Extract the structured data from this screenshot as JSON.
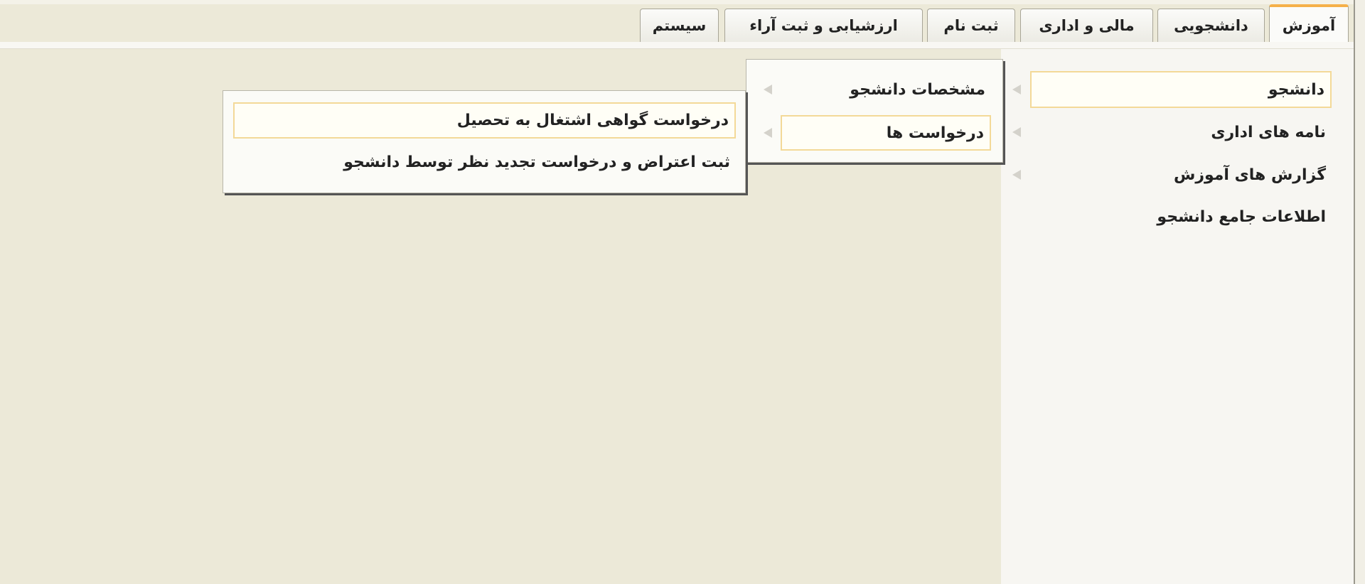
{
  "tabs": [
    {
      "label": "آموزش",
      "active": true
    },
    {
      "label": "دانشجویی"
    },
    {
      "label": "مالی و اداری"
    },
    {
      "label": "ثبت نام"
    },
    {
      "label": "ارزشیابی و ثبت آراء"
    },
    {
      "label": "سیستم"
    }
  ],
  "sidebar": {
    "items": [
      {
        "label": "دانشجو",
        "highlighted": true,
        "has_submenu": true
      },
      {
        "label": "نامه های اداری",
        "has_submenu": true
      },
      {
        "label": "گزارش های آموزش",
        "has_submenu": true
      },
      {
        "label": "اطلاعات جامع دانشجو"
      }
    ]
  },
  "submenu": {
    "items": [
      {
        "label": "مشخصات دانشجو",
        "has_submenu": true
      },
      {
        "label": "درخواست ها",
        "highlighted": true,
        "has_submenu": true
      }
    ]
  },
  "submenu2": {
    "items": [
      {
        "label": "درخواست گواهی اشتغال به تحصیل",
        "highlighted": true
      },
      {
        "label": "ثبت اعتراض و درخواست تجدید نظر توسط دانشجو"
      }
    ]
  },
  "colors": {
    "background": "#ece9d8",
    "active_tab_accent": "#f5b04a",
    "highlight_border": "#f3d998"
  }
}
